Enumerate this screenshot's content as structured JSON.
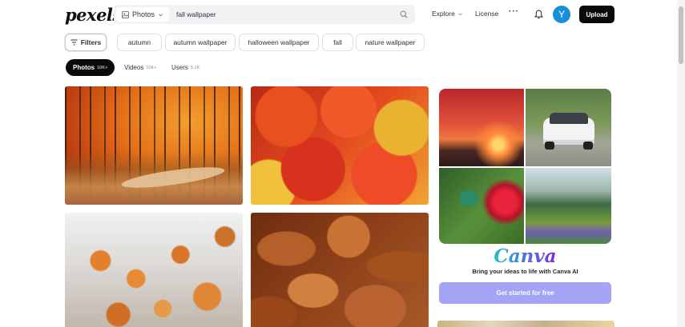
{
  "brand": {
    "logo": "pexels"
  },
  "search": {
    "type_label": "Photos",
    "query": "fall wallpaper",
    "icons": {
      "type": "image-icon",
      "chevron": "chevron-down-icon",
      "search": "search-icon"
    }
  },
  "nav": {
    "explore": "Explore",
    "license": "License",
    "more": "···",
    "bell_icon": "bell-icon",
    "avatar_initial": "Y",
    "upload": "Upload"
  },
  "filters": {
    "filters_label": "Filters",
    "chips": [
      "autumn",
      "autumn wallpaper",
      "halloween wallpaper",
      "fall",
      "nature wallpaper"
    ]
  },
  "tabs": [
    {
      "label": "Photos",
      "count": "10K+",
      "active": true
    },
    {
      "label": "Videos",
      "count": "10K+",
      "active": false
    },
    {
      "label": "Users",
      "count": "5.1K",
      "active": false
    }
  ],
  "ad": {
    "brand": "Canva",
    "tagline": "Bring your ideas to life with Canva AI",
    "cta": "Get started for free"
  },
  "colors": {
    "avatar": "#1a8fd8",
    "ad_cta": "#a5a3f5",
    "canva_gradient_start": "#1ec3c8",
    "canva_gradient_end": "#7c2ae8"
  }
}
